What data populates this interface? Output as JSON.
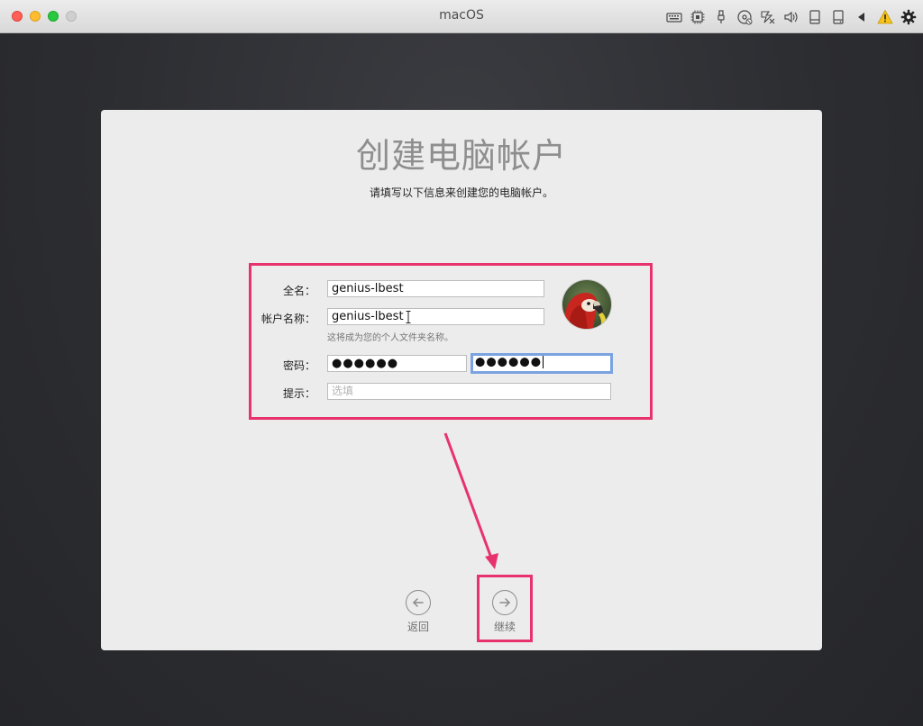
{
  "window": {
    "title": "macOS"
  },
  "toolbar_icons": [
    "keyboard-icon",
    "cpu-icon",
    "usb-icon",
    "cd-icon",
    "network-icon",
    "audio-icon",
    "drive-icon",
    "drive2-icon",
    "collapse-icon",
    "warning-icon",
    "settings-icon"
  ],
  "page": {
    "heading": "创建电脑帐户",
    "subheading": "请填写以下信息来创建您的电脑帐户。"
  },
  "form": {
    "full_name_label": "全名：",
    "full_name_value": "genius-lbest",
    "account_name_label": "帐户名称：",
    "account_name_value": "genius-lbest",
    "account_note": "这将成为您的个人文件夹名称。",
    "password_label": "密码：",
    "password_value": "●●●●●●",
    "verify_value": "●●●●●●",
    "hint_label": "提示：",
    "hint_placeholder": "选填"
  },
  "navigation": {
    "back_label": "返回",
    "continue_label": "继续"
  },
  "colors": {
    "highlight": "#e8326e",
    "focus_ring": "#7aa3e0"
  }
}
